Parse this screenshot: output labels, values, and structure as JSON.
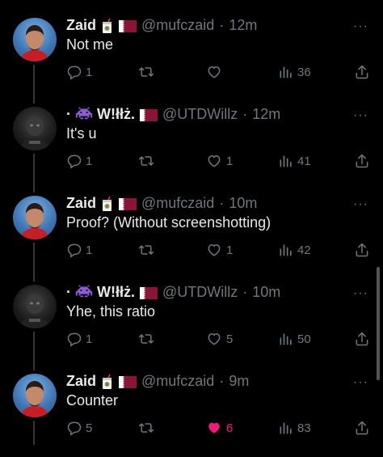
{
  "colors": {
    "background": "#000000",
    "text": "#e7e9ea",
    "muted": "#71767b",
    "like_active": "#f91880"
  },
  "tweets": [
    {
      "name": "Zaid",
      "handle": "@mufczaid",
      "time": "12m",
      "text": "Not me",
      "replies": "1",
      "retweets": "",
      "likes": "",
      "views": "36",
      "liked": false,
      "avatar": "zaid"
    },
    {
      "name": "W!łłż.",
      "handle": "@UTDWillz",
      "time": "12m",
      "text": "It's u",
      "replies": "1",
      "retweets": "",
      "likes": "1",
      "views": "41",
      "liked": false,
      "avatar": "willz"
    },
    {
      "name": "Zaid",
      "handle": "@mufczaid",
      "time": "10m",
      "text": "Proof? (Without screenshotting)",
      "replies": "1",
      "retweets": "",
      "likes": "1",
      "views": "42",
      "liked": false,
      "avatar": "zaid"
    },
    {
      "name": "W!łłż.",
      "handle": "@UTDWillz",
      "time": "10m",
      "text": "Yhe, this ratio",
      "replies": "1",
      "retweets": "",
      "likes": "5",
      "views": "50",
      "liked": false,
      "avatar": "willz"
    },
    {
      "name": "Zaid",
      "handle": "@mufczaid",
      "time": "9m",
      "text": "Counter",
      "replies": "5",
      "retweets": "",
      "likes": "6",
      "views": "83",
      "liked": true,
      "avatar": "zaid"
    }
  ],
  "icons": {
    "reply": "reply-icon",
    "retweet": "retweet-icon",
    "like": "heart-icon",
    "views": "views-icon",
    "share": "share-icon",
    "more": "more-icon",
    "juice": "juice-box-icon",
    "flag": "qatar-flag-icon",
    "alien": "space-invader-icon"
  }
}
